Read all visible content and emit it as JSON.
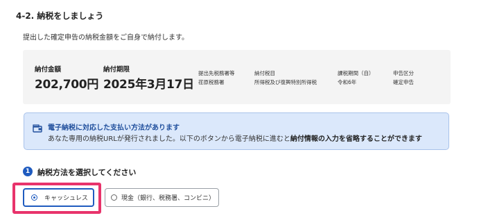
{
  "heading": "4-2. 納税をしましょう",
  "intro": "提出した確定申告の納税金額をご自身で納付します。",
  "summary": {
    "amount_label": "納付金額",
    "amount_value": "202,700円",
    "deadline_label": "納付期限",
    "deadline_value": "2025年3月17日",
    "office_label": "提出先税務署等",
    "office_value": "荏原税務署",
    "tax_item_label": "納付税目",
    "tax_item_value": "所得税及び復興特別所得税",
    "period_label": "課税期間（自）",
    "period_value": "令和6年",
    "filing_type_label": "申告区分",
    "filing_type_value": "確定申告"
  },
  "info": {
    "icon": "wallet-icon",
    "title": "電子納税に対応した支払い方法があります",
    "body_prefix": "あなた専用の納税URLが発行されました。以下のボタンから電子納税に進むと",
    "body_bold": "納付情報の入力を省略することができます"
  },
  "step": {
    "number": "1",
    "title": "納税方法を選択してください"
  },
  "options": {
    "cashless": "キャッシュレス",
    "cash": "現金（銀行、税務署、コンビニ）",
    "selected": "cashless"
  },
  "colors": {
    "accent": "#1f5bbf",
    "highlight": "#e8336b",
    "info_bg": "#dbe8fb",
    "summary_bg": "#f4f4f4"
  }
}
